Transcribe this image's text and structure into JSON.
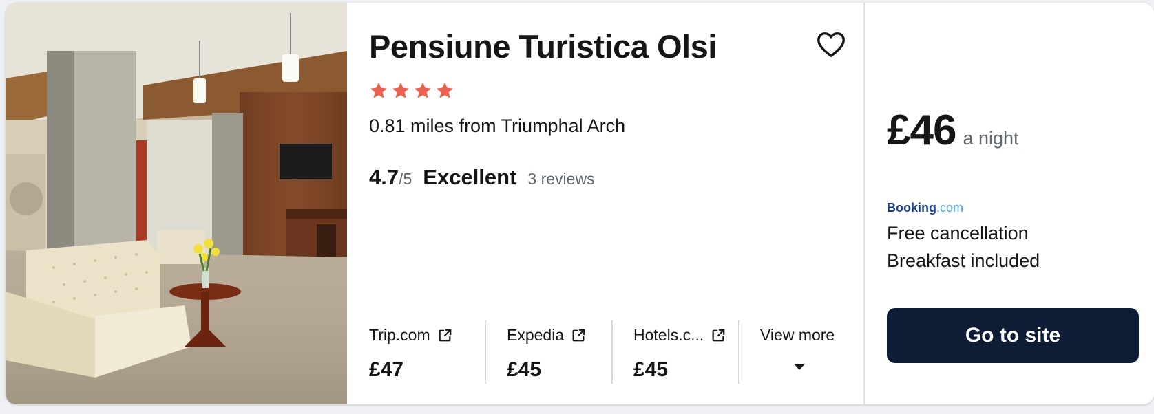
{
  "hotel": {
    "name": "Pensiune Turistica Olsi",
    "star_count": 4,
    "star_color": "#e8624f",
    "distance": "0.81 miles from Triumphal Arch",
    "photo_icon": "hotel-lobby-photo"
  },
  "rating": {
    "score": "4.7",
    "max": "/5",
    "label": "Excellent",
    "reviews": "3 reviews"
  },
  "providers": [
    {
      "name": "Trip.com",
      "price": "£47",
      "icon": "external-link-icon"
    },
    {
      "name": "Expedia",
      "price": "£45",
      "icon": "external-link-icon"
    },
    {
      "name": "Hotels.c...",
      "price": "£45",
      "icon": "external-link-icon"
    },
    {
      "name": "View more",
      "icon": "chevron-down-icon"
    }
  ],
  "offer": {
    "price": "£46",
    "per": "a night",
    "provider_logo": {
      "part1": "Booking",
      "part2": ".com"
    },
    "perks": [
      "Free cancellation",
      "Breakfast included"
    ],
    "cta": "Go to site"
  },
  "colors": {
    "accent_star": "#e8624f",
    "cta_bg": "#0e1c36",
    "muted_text": "#626971"
  }
}
